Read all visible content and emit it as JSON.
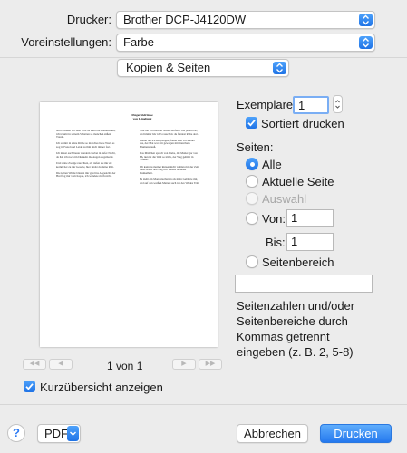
{
  "printer": {
    "label": "Drucker:",
    "value": "Brother DCP-J4120DW"
  },
  "presets": {
    "label": "Voreinstellungen:",
    "value": "Farbe"
  },
  "section": {
    "value": "Kopien & Seiten"
  },
  "copies": {
    "label": "Exemplare:",
    "value": "1",
    "collate_label": "Sortiert drucken"
  },
  "pages": {
    "label": "Seiten:",
    "all": "Alle",
    "current": "Aktuelle Seite",
    "selection": "Auswahl",
    "from_label": "Von:",
    "from_value": "1",
    "to_label": "Bis:",
    "to_value": "1",
    "range_label": "Seitenbereich",
    "range_value": "",
    "hint": "Seitenzahlen und/oder Seitenbereiche durch Kommas getrennt eingeben (z. B. 2, 5-8)"
  },
  "preview": {
    "title": "Fingerabdrücke\nvon Lüneburg",
    "page_indicator": "1 von 1",
    "summary_label": "Kurzübersicht anzeigen",
    "col1": [
      "Am Brunnen vor dem Tore da steht ein Lindenbaum, ich träumt in seinem Schatten so manchen süßen Traum.",
      "Ich schnitt in seine Rinde so manches liebe Wort, es zog in Freud und Leide zu ihm mich immer fort.",
      "Ich musst auch heute wandern vorbei in tiefer Nacht, da hab ich noch im Dunkeln die Augen zugemacht.",
      "Und seine Zweige rauschten, als riefen sie mir zu: komm her zu mir Geselle, hier findst du deine Ruh.",
      "Die kalten Winde bliesen mir grad ins Angesicht, der Hut flog mir vom Kopfe, ich wendete mich nicht."
    ],
    "col2": [
      "Nun bin ich manche Stunde entfernt von jenem Ort, und immer hör ich's rauschen: du fändest Ruhe dort.",
      "Fremd bin ich eingezogen, fremd zieh ich wieder aus, der Mai war mir gewogen mit manchem Blumenstrauß.",
      "Das Mädchen sprach von Liebe, die Mutter gar von Eh, nun ist die Welt so trübe, der Weg gehüllt in Schnee.",
      "Ich kann zu meiner Reisen nicht wählen mit der Zeit, muss selbst den Weg mir weisen in dieser Dunkelheit.",
      "Es zieht ein Mondenschatten als mein Gefährte mit, und auf den weißen Matten such ich des Wildes Tritt."
    ]
  },
  "footer": {
    "help": "?",
    "pdf": "PDF",
    "cancel": "Abbrechen",
    "print": "Drucken"
  }
}
